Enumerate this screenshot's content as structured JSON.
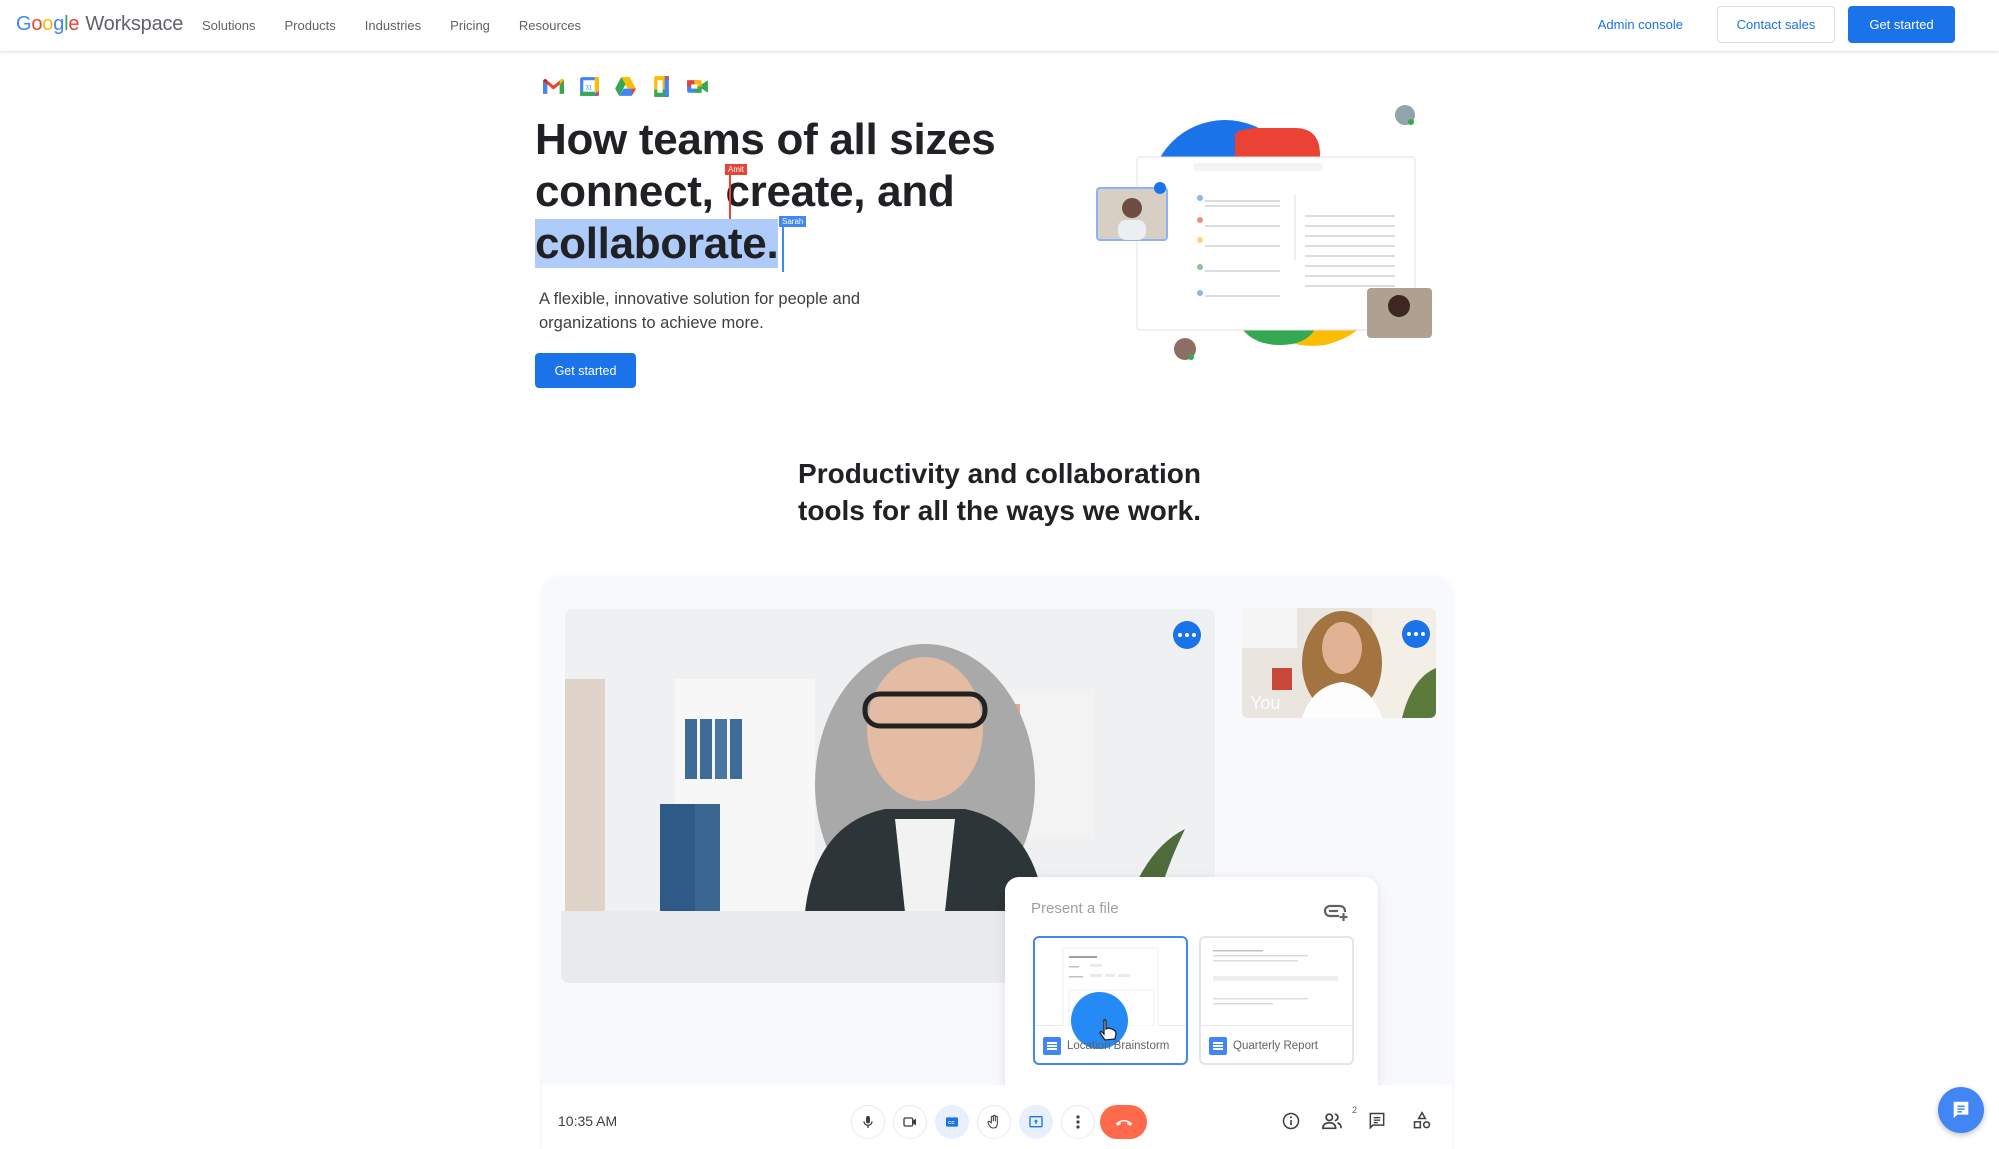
{
  "header": {
    "logo": {
      "google": [
        "G",
        "o",
        "o",
        "g",
        "l",
        "e"
      ],
      "product": "Workspace"
    },
    "nav": [
      "Solutions",
      "Products",
      "Industries",
      "Pricing",
      "Resources"
    ],
    "admin_console": "Admin console",
    "contact_sales": "Contact sales",
    "get_started": "Get started"
  },
  "hero": {
    "app_icons": [
      "gmail-icon",
      "calendar-icon",
      "drive-icon",
      "docs-icon",
      "meet-icon"
    ],
    "title_line1": "How teams of all sizes",
    "title_line2a": "connect, ",
    "title_line2b": "create, and",
    "title_line3": "collaborate.",
    "cursor_tags": {
      "red": "Amit",
      "blue": "Sarah"
    },
    "subtitle": "A flexible, innovative solution for people and organizations to achieve more.",
    "cta": "Get started"
  },
  "section": {
    "title_line1": "Productivity and collaboration",
    "title_line2": "tools for all the ways we work."
  },
  "meet": {
    "self_label": "You",
    "present_title": "Present a file",
    "files": [
      {
        "name": "Location Brainstorm",
        "selected": true
      },
      {
        "name": "Quarterly Report",
        "selected": false
      }
    ],
    "time": "10:35 AM",
    "participants_count": "2"
  },
  "colors": {
    "accent": "#1a73e8",
    "highlight": "#aecbfa",
    "end_call": "#ff6b4a",
    "google_blue": "#4285f4",
    "google_red": "#ea4335",
    "google_yellow": "#fbbc04",
    "google_green": "#34a853"
  }
}
